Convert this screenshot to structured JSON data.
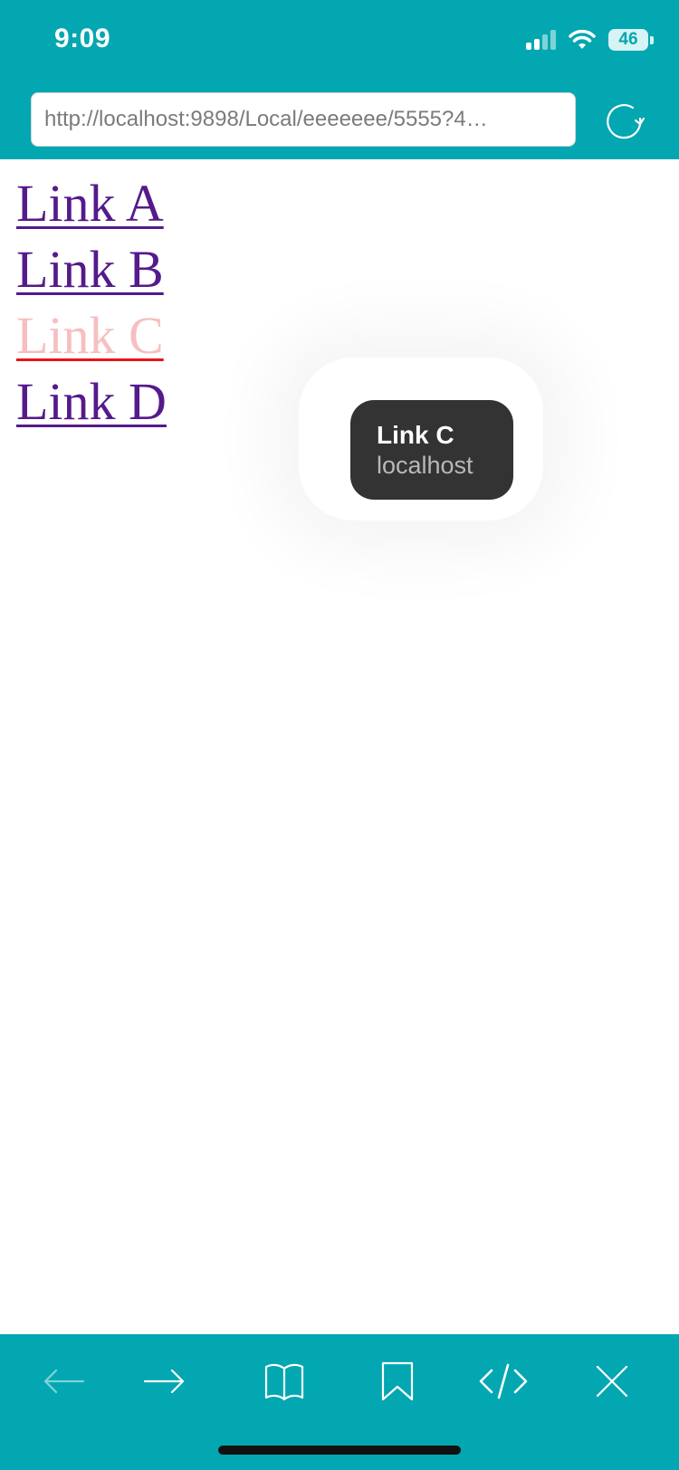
{
  "status_bar": {
    "time": "9:09",
    "battery_level": "46",
    "icons": [
      "cellular-signal-icon",
      "wifi-icon",
      "battery-icon"
    ]
  },
  "browser": {
    "url": "http://localhost:9898/Local/eeeeeee/5555?4…",
    "reload_icon": "reload-icon"
  },
  "page": {
    "links": [
      {
        "label": "Link A",
        "state": "visited"
      },
      {
        "label": "Link B",
        "state": "visited"
      },
      {
        "label": "Link C",
        "state": "active"
      },
      {
        "label": "Link D",
        "state": "visited"
      }
    ]
  },
  "tooltip": {
    "title": "Link C",
    "subtitle": "localhost"
  },
  "toolbar": {
    "items": [
      {
        "icon": "back-arrow-icon",
        "enabled": false
      },
      {
        "icon": "forward-arrow-icon",
        "enabled": true
      },
      {
        "icon": "book-icon",
        "enabled": true
      },
      {
        "icon": "bookmark-icon",
        "enabled": true
      },
      {
        "icon": "code-icon",
        "enabled": true
      },
      {
        "icon": "close-icon",
        "enabled": true
      }
    ]
  },
  "colors": {
    "accent": "#02a7b1",
    "visited_link": "#551a8b",
    "active_link_text": "#f6bfc0",
    "active_link_underline": "#e8141b",
    "tooltip_background": "#333333"
  }
}
